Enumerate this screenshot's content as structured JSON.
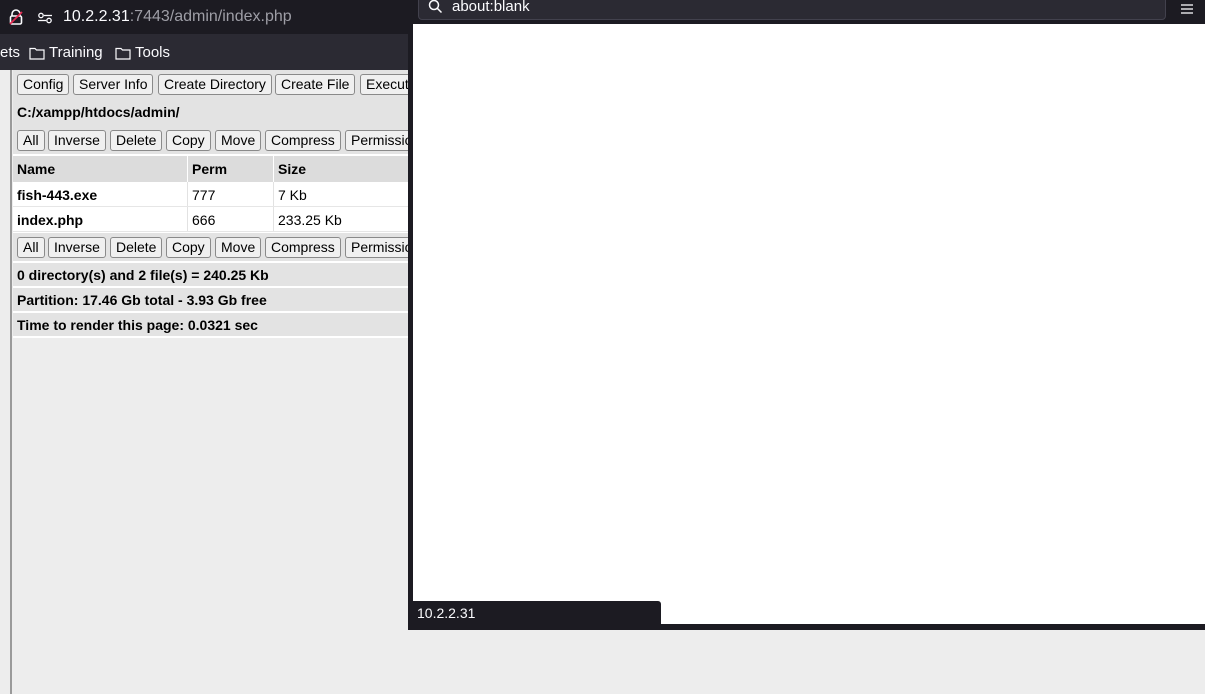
{
  "browser": {
    "url_host": "10.2.2.31",
    "url_path": ":7443/admin/index.php",
    "bookmarks": [
      {
        "label": "ets"
      },
      {
        "label": "Training"
      },
      {
        "label": "Tools"
      }
    ]
  },
  "toolbar": {
    "buttons": [
      "Config",
      "Server Info",
      "Create Directory",
      "Create File",
      "Execut"
    ]
  },
  "current_path": "C:/xampp/htdocs/admin/",
  "actions": [
    "All",
    "Inverse",
    "Delete",
    "Copy",
    "Move",
    "Compress",
    "Permissio"
  ],
  "table": {
    "headers": [
      "Name",
      "Perm",
      "Size"
    ],
    "rows": [
      {
        "name": "fish-443.exe",
        "perm": "777",
        "size": "7 Kb"
      },
      {
        "name": "index.php",
        "perm": "666",
        "size": "233.25 Kb"
      }
    ]
  },
  "footer": {
    "summary": "0 directory(s) and 2 file(s) = 240.25 Kb",
    "partition": "Partition: 17.46 Gb total - 3.93 Gb free",
    "render_time": "Time to render this page: 0.0321 sec"
  },
  "popup": {
    "address": "about:blank",
    "status": "10.2.2.31"
  }
}
